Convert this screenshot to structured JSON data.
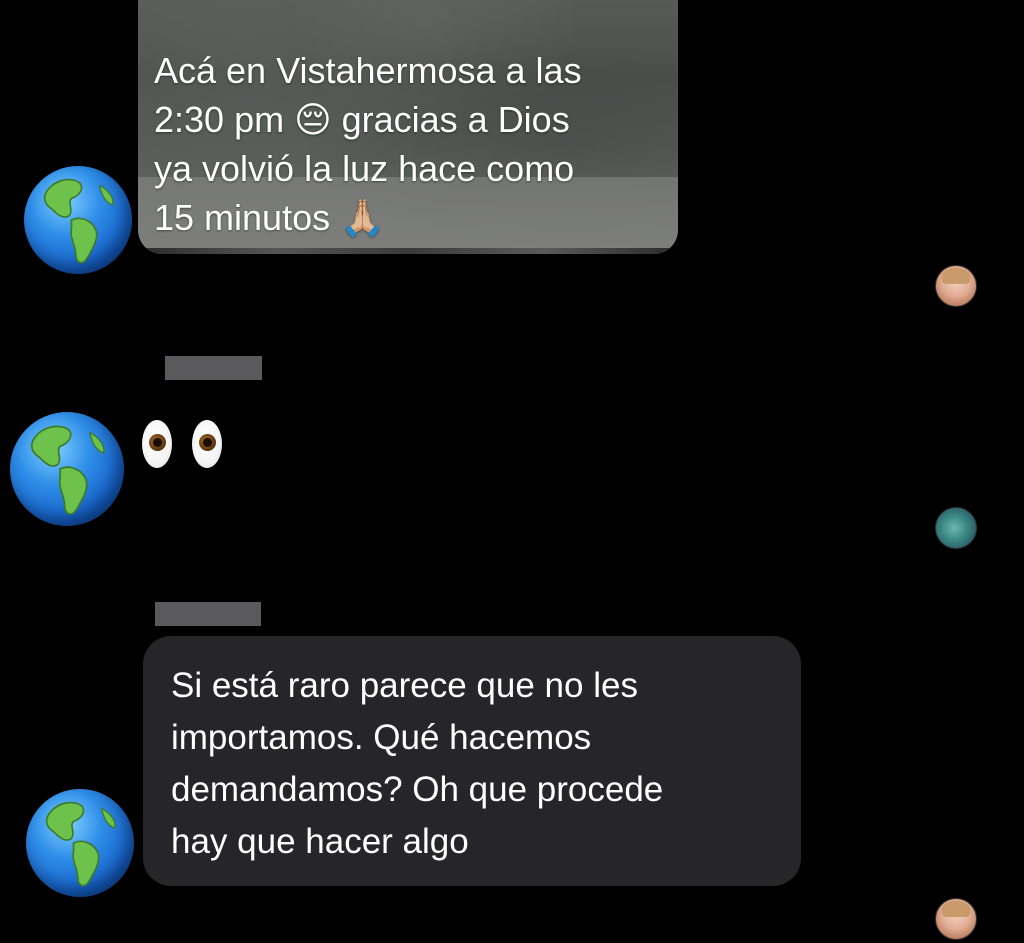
{
  "messages": [
    {
      "kind": "image",
      "caption": "Acá en Vistahermosa a las\n2:30 pm  😔 gracias a Dios\nya volvió la luz hace como\n15 minutos 🙏🏼"
    },
    {
      "kind": "emoji",
      "content_icon": "eyes-emoji"
    },
    {
      "kind": "text",
      "text": "Si está raro parece que no les\nimportamos. Qué hacemos\ndemandamos? Oh que procede\nhay que hacer algo"
    }
  ],
  "avatar_icon": "globe-americas-icon",
  "colors": {
    "background": "#000000",
    "bubble": "#262628",
    "text": "#ffffff",
    "name_redaction": "#5a5a5c"
  }
}
